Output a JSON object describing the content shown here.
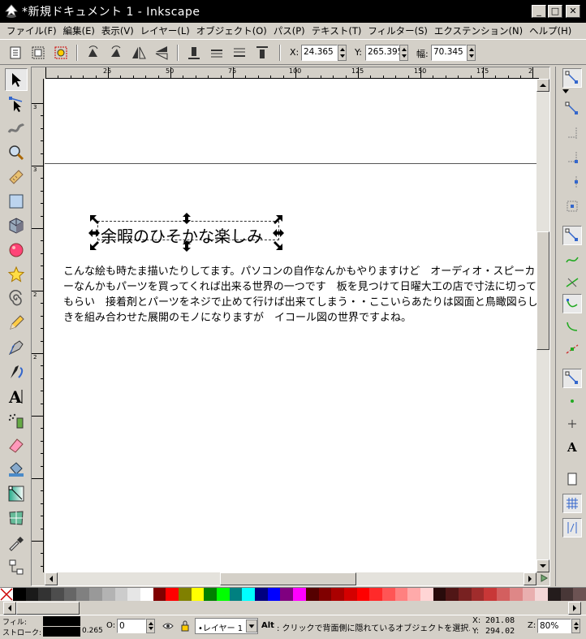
{
  "window": {
    "title": "*新規ドキュメント 1 - Inkscape",
    "minimize": "_",
    "maximize": "□",
    "close": "✕"
  },
  "menu": [
    "ファイル(F)",
    "編集(E)",
    "表示(V)",
    "レイヤー(L)",
    "オブジェクト(O)",
    "パス(P)",
    "テキスト(T)",
    "フィルター(S)",
    "エクステンション(N)",
    "ヘルプ(H)"
  ],
  "toolbar": {
    "x_label": "X:",
    "x_value": "24.365",
    "y_label": "Y:",
    "y_value": "265.395",
    "w_label": "幅:",
    "w_value": "70.345"
  },
  "ruler": {
    "h_ticks": [
      "25",
      "50",
      "75",
      "100",
      "125",
      "150",
      "175",
      "2"
    ],
    "v_ticks": [
      "3",
      "3",
      "2",
      "2"
    ]
  },
  "canvas": {
    "heading": "余暇のひそかな楽しみ",
    "body": "こんな絵も時たま描いたりしてます。パソコンの自作なんかもやりますけど　オーディオ・スピーカーなんかもパーツを買ってくれば出来る世界の一つです　板を見つけて日曜大工の店で寸法に切ってもらい　接着剤とパーツをネジで止めて行けば出来てしまう・・ここいらあたりは図面と鳥瞰図らしきを組み合わせた展開のモノになりますが　イコール図の世界ですよね。"
  },
  "palette": [
    "#000000",
    "#1a1a1a",
    "#333333",
    "#4d4d4d",
    "#666666",
    "#808080",
    "#999999",
    "#b3b3b3",
    "#cccccc",
    "#e6e6e6",
    "#ffffff",
    "#800000",
    "#ff0000",
    "#808000",
    "#ffff00",
    "#008000",
    "#00ff00",
    "#008080",
    "#00ffff",
    "#000080",
    "#0000ff",
    "#800080",
    "#ff00ff",
    "#550000",
    "#800000",
    "#aa0000",
    "#d40000",
    "#ff0000",
    "#ff2a2a",
    "#ff5555",
    "#ff8080",
    "#ffaaaa",
    "#ffd5d5",
    "#280b0b",
    "#501616",
    "#782121",
    "#a02c2c",
    "#c83737",
    "#d35f5f",
    "#de8787",
    "#e9afaf",
    "#f4d7d7",
    "#241c1c",
    "#483737",
    "#6c5353"
  ],
  "status": {
    "fill_label": "フィル:",
    "stroke_label": "ストローク:",
    "stroke_width": "0.265",
    "opacity_label": "O:",
    "opacity_value": "0",
    "layer": "•レイヤー 1",
    "message_bold": "Alt",
    "message": ": クリックで背面側に隠れているオブジェクトを選択…",
    "coord_x_label": "X:",
    "coord_x": "201.08",
    "coord_y_label": "Y:",
    "coord_y": "294.02",
    "zoom_label": "Z:",
    "zoom": "80%"
  }
}
